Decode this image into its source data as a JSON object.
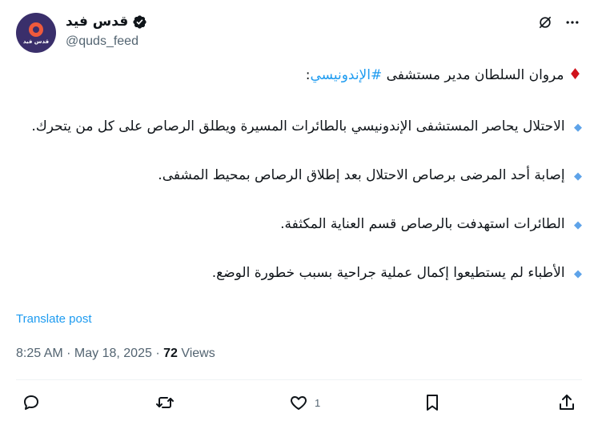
{
  "author": {
    "display_name": "قدس فيد",
    "handle": "@quds_feed",
    "avatar_text": "قدس فيد"
  },
  "tweet": {
    "intro": "مروان السلطان مدير مستشفى",
    "hashtag": "#الإندونيسي",
    "intro_suffix": ":",
    "points": [
      "الاحتلال يحاصر المستشفى الإندونيسي بالطائرات المسيرة ويطلق الرصاص على كل من يتحرك.",
      "إصابة أحد المرضى برصاص الاحتلال بعد إطلاق الرصاص بمحيط المشفى.",
      "الطائرات استهدفت بالرصاص قسم العناية المكثفة.",
      "الأطباء لم يستطيعوا إكمال عملية جراحية بسبب خطورة الوضع."
    ],
    "red_diamond": "♦",
    "blue_diamond": "◆"
  },
  "translate_label": "Translate post",
  "meta": {
    "time": "8:25 AM",
    "sep1": " · ",
    "date": "May 18, 2025",
    "sep2": " · ",
    "views_count": "72",
    "views_label": " Views"
  },
  "actions": {
    "like_count": "1"
  },
  "colors": {
    "accent": "#1d9bf0",
    "text": "#0f1419",
    "muted": "#536471",
    "divider": "#eff3f4"
  },
  "icons": [
    "verified-badge-icon",
    "grok-icon",
    "more-icon",
    "reply-icon",
    "retweet-icon",
    "like-icon",
    "bookmark-icon",
    "share-icon"
  ]
}
